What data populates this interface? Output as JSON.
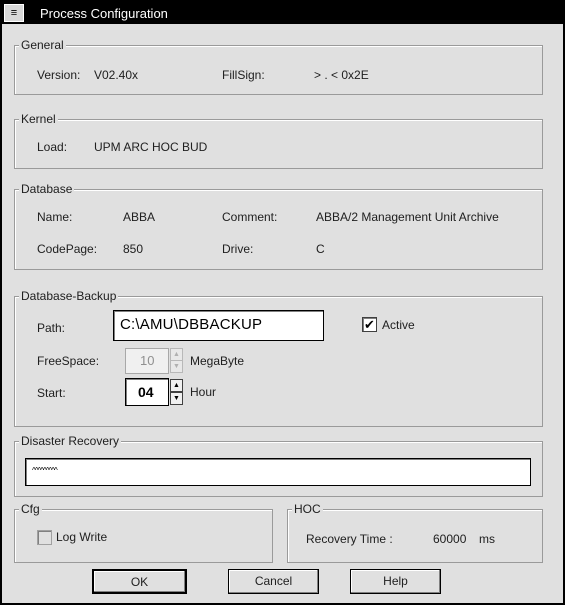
{
  "window": {
    "title": "Process Configuration",
    "sysmenu_glyph": "≡"
  },
  "general": {
    "legend": "General",
    "version_label": "Version:",
    "version_value": "V02.40x",
    "fillsign_label": "FillSign:",
    "fillsign_value": "> . < 0x2E"
  },
  "kernel": {
    "legend": "Kernel",
    "load_label": "Load:",
    "load_value": "UPM ARC HOC BUD"
  },
  "database": {
    "legend": "Database",
    "name_label": "Name:",
    "name_value": "ABBA",
    "comment_label": "Comment:",
    "comment_value": "ABBA/2 Management Unit Archive",
    "codepage_label": "CodePage:",
    "codepage_value": "850",
    "drive_label": "Drive:",
    "drive_value": "C"
  },
  "backup": {
    "legend": "Database-Backup",
    "path_label": "Path:",
    "path_value": "C:\\AMU\\DBBACKUP",
    "active_label": "Active",
    "active_checked": true,
    "active_mark": "✔",
    "freespace_label": "FreeSpace:",
    "freespace_value": "10",
    "freespace_unit": "MegaByte",
    "start_label": "Start:",
    "start_value": "04",
    "start_unit": "Hour",
    "spin_up": "▲",
    "spin_down": "▼"
  },
  "disaster": {
    "legend": "Disaster Recovery",
    "value": "^^^^^^^^^"
  },
  "cfg": {
    "legend": "Cfg",
    "logwrite_label": "Log Write",
    "logwrite_checked": false
  },
  "hoc": {
    "legend": "HOC",
    "recovery_label": "Recovery Time :",
    "recovery_value": "60000",
    "recovery_unit": "ms"
  },
  "buttons": {
    "ok": "OK",
    "cancel": "Cancel",
    "help": "Help"
  }
}
